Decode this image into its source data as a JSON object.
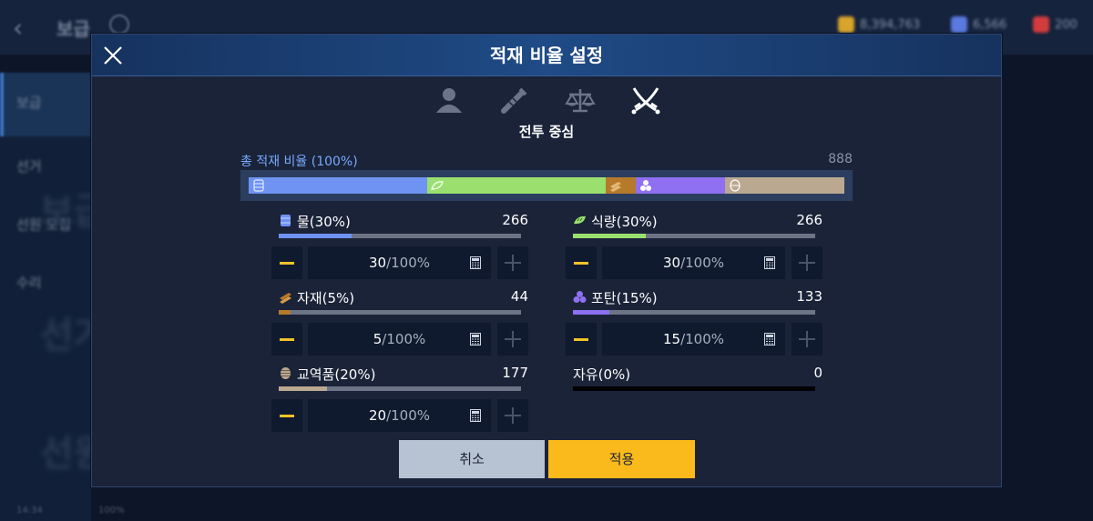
{
  "background": {
    "back_label": "‹",
    "title": "보급",
    "resources": [
      {
        "name": "gold",
        "value": "8,394,763",
        "color": "#d8a52a"
      },
      {
        "name": "gem",
        "value": "6,566",
        "color": "#5b7ae0"
      },
      {
        "name": "ruby",
        "value": "200",
        "color": "#d23c3c"
      }
    ],
    "sidebar_items": [
      "보급",
      "선거",
      "선원 모집",
      "수리"
    ],
    "ghost_texts": [
      "보급",
      "선거",
      "선원"
    ],
    "status_left": "14:34",
    "status_battery": "100%"
  },
  "modal": {
    "title": "적재 비율 설정",
    "mode_tabs": [
      {
        "icon": "person-icon",
        "active": false
      },
      {
        "icon": "spyglass-icon",
        "active": false
      },
      {
        "icon": "balance-scale-icon",
        "active": false
      },
      {
        "icon": "crossed-swords-icon",
        "active": true
      }
    ],
    "mode_label": "전투 중심",
    "total": {
      "label": "총 적재 비율 (100%)",
      "count": "888",
      "segments": [
        {
          "name": "water",
          "percent": 30,
          "color": "#6f93f3"
        },
        {
          "name": "food",
          "percent": 30,
          "color": "#9be06f"
        },
        {
          "name": "material",
          "percent": 5,
          "color": "#b57a2a"
        },
        {
          "name": "ammo",
          "percent": 15,
          "color": "#8f6ff2"
        },
        {
          "name": "goods",
          "percent": 20,
          "color": "#bba891"
        }
      ]
    },
    "resources": [
      {
        "key": "water",
        "name": "물(30%)",
        "count": "266",
        "value": "30",
        "unit": "/100%",
        "fill": 0.3,
        "color": "#6f93f3",
        "icon": "water-barrel-icon"
      },
      {
        "key": "food",
        "name": "식량(30%)",
        "count": "266",
        "value": "30",
        "unit": "/100%",
        "fill": 0.3,
        "color": "#9be06f",
        "icon": "bread-icon"
      },
      {
        "key": "material",
        "name": "자재(5%)",
        "count": "44",
        "value": "5",
        "unit": "/100%",
        "fill": 0.05,
        "color": "#b57a2a",
        "icon": "lumber-icon"
      },
      {
        "key": "ammo",
        "name": "포탄(15%)",
        "count": "133",
        "value": "15",
        "unit": "/100%",
        "fill": 0.15,
        "color": "#8f6ff2",
        "icon": "cannonball-icon"
      },
      {
        "key": "goods",
        "name": "교역품(20%)",
        "count": "177",
        "value": "20",
        "unit": "/100%",
        "fill": 0.2,
        "color": "#bba891",
        "icon": "cargo-barrel-icon"
      }
    ],
    "free": {
      "name": "자유(0%)",
      "count": "0",
      "fill": 0
    },
    "cancel_label": "취소",
    "apply_label": "적용"
  }
}
